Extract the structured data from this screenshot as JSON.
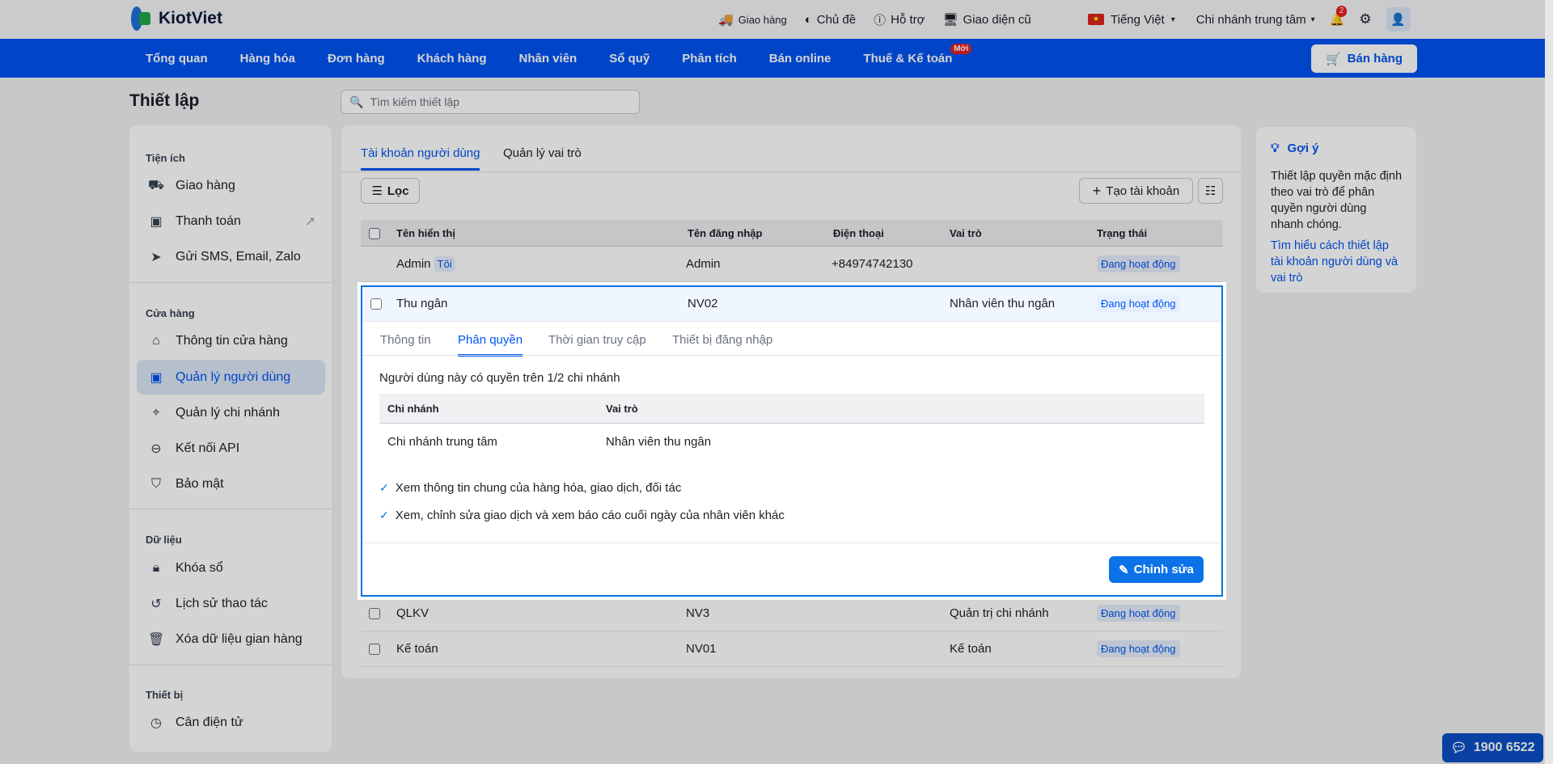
{
  "header": {
    "brand": "KiotViet",
    "tools": [
      {
        "label": "Giao hàng",
        "icon": "delivery-icon"
      },
      {
        "label": "Chủ đề",
        "icon": "palette-icon"
      },
      {
        "label": "Hỗ trợ",
        "icon": "support-icon"
      },
      {
        "label": "Giao diện cũ",
        "icon": "monitor-icon"
      }
    ],
    "language": "Tiếng Việt",
    "branch": "Chi nhánh trung tâm",
    "notifications": "2"
  },
  "nav": {
    "items": [
      "Tổng quan",
      "Hàng hóa",
      "Đơn hàng",
      "Khách hàng",
      "Nhân viên",
      "Sổ quỹ",
      "Phân tích",
      "Bán online",
      "Thuế & Kế toán"
    ],
    "new_badge": "Mới",
    "sell": "Bán hàng"
  },
  "page": {
    "title": "Thiết lập",
    "search_placeholder": "Tìm kiếm thiết lập"
  },
  "sidebar": {
    "sections": [
      {
        "title": "Tiện ích",
        "items": [
          "Giao hàng",
          "Thanh toán",
          "Gửi SMS, Email, Zalo"
        ]
      },
      {
        "title": "Cửa hàng",
        "items": [
          "Thông tin cửa hàng",
          "Quản lý người dùng",
          "Quản lý chi nhánh",
          "Kết nối API",
          "Bảo mật"
        ]
      },
      {
        "title": "Dữ liệu",
        "items": [
          "Khóa sổ",
          "Lịch sử thao tác",
          "Xóa dữ liệu gian hàng"
        ]
      },
      {
        "title": "Thiết bị",
        "items": [
          "Cân điện tử"
        ]
      }
    ]
  },
  "main": {
    "tabs": [
      "Tài khoản người dùng",
      "Quản lý vai trò"
    ],
    "filter": "Lọc",
    "create": "Tạo tài khoản",
    "columns": [
      "Tên hiển thị",
      "Tên đăng nhập",
      "Điện thoại",
      "Vai trò",
      "Trạng thái"
    ],
    "rows": [
      {
        "name": "Admin",
        "tag": "Tôi",
        "login": "Admin",
        "phone": "+84974742130",
        "role": "",
        "status": "Đang hoạt động"
      },
      {
        "name": "Thu ngân",
        "login": "NV02",
        "phone": "",
        "role": "Nhân viên thu ngân",
        "status": "Đang hoạt động"
      },
      {
        "name": "QLKV",
        "login": "NV3",
        "phone": "",
        "role": "Quản trị chi nhánh",
        "status": "Đang hoạt động"
      },
      {
        "name": "Kế toán",
        "login": "NV01",
        "phone": "",
        "role": "Kế toán",
        "status": "Đang hoạt động"
      }
    ]
  },
  "detail": {
    "tabs": [
      "Thông tin",
      "Phân quyền",
      "Thời gian truy cập",
      "Thiết bị đăng nhập"
    ],
    "summary": "Người dùng này có quyền trên 1/2 chi nhánh",
    "columns": [
      "Chi nhánh",
      "Vai trò"
    ],
    "branch_rows": [
      {
        "branch": "Chi nhánh trung tâm",
        "role": "Nhân viên thu ngân"
      }
    ],
    "permissions": [
      "Xem thông tin chung của hàng hóa, giao dịch, đối tác",
      "Xem, chỉnh sửa giao dịch và xem báo cáo cuối ngày của nhân viên khác"
    ],
    "edit": "Chỉnh sửa"
  },
  "hint": {
    "title": "Gợi ý",
    "text": "Thiết lập quyền mặc định theo vai trò để phân quyền người dùng nhanh chóng.",
    "link": "Tìm hiểu cách thiết lập tài khoản người dùng và vai trò"
  },
  "hotline": "1900 6522",
  "colors": {
    "brand": "#0054f1",
    "accent": "#0b72e7"
  }
}
